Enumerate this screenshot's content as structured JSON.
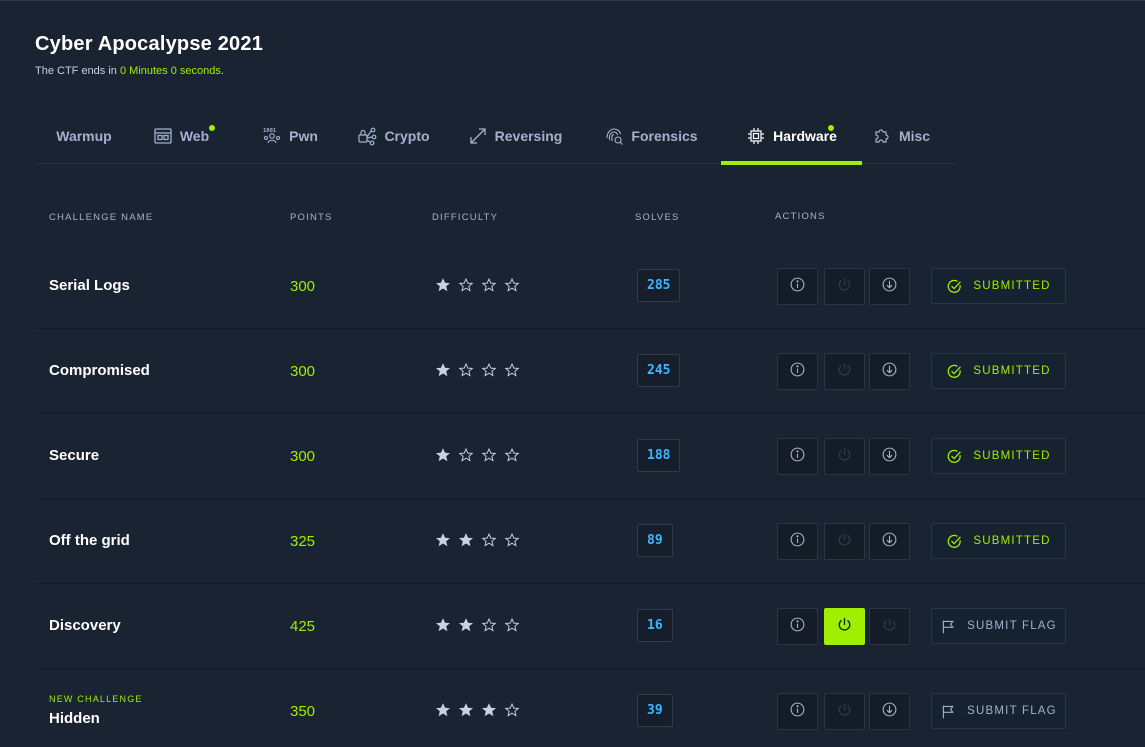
{
  "header": {
    "title": "Cyber Apocalypse 2021",
    "subtitle_prefix": "The CTF ends in ",
    "subtitle_time": "0 Minutes 0 seconds",
    "subtitle_suffix": "."
  },
  "tabs": [
    {
      "label": "Warmup",
      "icon": "none",
      "active": false,
      "dot": false
    },
    {
      "label": "Web",
      "icon": "browser-window-icon",
      "active": false,
      "dot": true
    },
    {
      "label": "Pwn",
      "icon": "binary-user-icon",
      "active": false,
      "dot": false
    },
    {
      "label": "Crypto",
      "icon": "lock-network-icon",
      "active": false,
      "dot": false
    },
    {
      "label": "Reversing",
      "icon": "reverse-arrows-icon",
      "active": false,
      "dot": false
    },
    {
      "label": "Forensics",
      "icon": "fingerprint-search-icon",
      "active": false,
      "dot": false
    },
    {
      "label": "Hardware",
      "icon": "chip-icon",
      "active": true,
      "dot": true
    },
    {
      "label": "Misc",
      "icon": "puzzle-icon",
      "active": false,
      "dot": false
    }
  ],
  "columns": {
    "name": "CHALLENGE NAME",
    "points": "POINTS",
    "difficulty": "DIFFICULTY",
    "solves": "SOLVES",
    "actions": "ACTIONS"
  },
  "challenges": [
    {
      "name": "Serial Logs",
      "points": "300",
      "difficulty": 1,
      "solves": "285",
      "status": "SUBMITTED",
      "spawn_active": false,
      "download_enabled": true,
      "new_tag": ""
    },
    {
      "name": "Compromised",
      "points": "300",
      "difficulty": 1,
      "solves": "245",
      "status": "SUBMITTED",
      "spawn_active": false,
      "download_enabled": true,
      "new_tag": ""
    },
    {
      "name": "Secure",
      "points": "300",
      "difficulty": 1,
      "solves": "188",
      "status": "SUBMITTED",
      "spawn_active": false,
      "download_enabled": true,
      "new_tag": ""
    },
    {
      "name": "Off the grid",
      "points": "325",
      "difficulty": 2,
      "solves": "89",
      "status": "SUBMITTED",
      "spawn_active": false,
      "download_enabled": true,
      "new_tag": ""
    },
    {
      "name": "Discovery",
      "points": "425",
      "difficulty": 2,
      "solves": "16",
      "status": "SUBMIT FLAG",
      "spawn_active": true,
      "download_enabled": false,
      "new_tag": ""
    },
    {
      "name": "Hidden",
      "points": "350",
      "difficulty": 3,
      "solves": "39",
      "status": "SUBMIT FLAG",
      "spawn_active": false,
      "download_enabled": true,
      "new_tag": "NEW CHALLENGE"
    }
  ],
  "colors": {
    "accent": "#9fef00",
    "background": "#1a2332",
    "solves_text": "#3fb7ff",
    "muted": "#a4b1cd"
  }
}
